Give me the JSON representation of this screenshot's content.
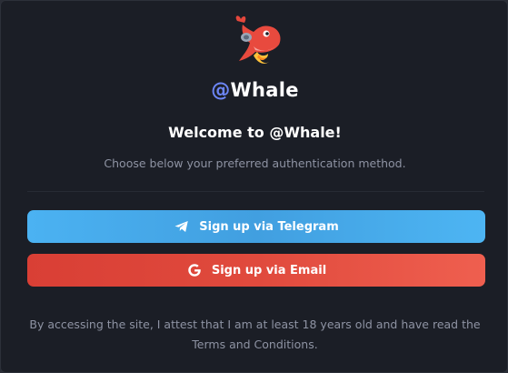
{
  "brand": {
    "at": "@",
    "name": "Whale"
  },
  "modal": {
    "title": "Welcome to @Whale!",
    "subtitle": "Choose below your preferred authentication method."
  },
  "buttons": {
    "telegram_label": "Sign up via Telegram",
    "email_label": "Sign up via Email"
  },
  "footer": {
    "text": "By accessing the site, I attest that I am at least 18 years old and have read the",
    "terms_link": "Terms and Conditions."
  },
  "icons": {
    "mascot": "whale-mascot-icon",
    "telegram": "telegram-icon",
    "email": "google-icon"
  },
  "colors": {
    "background": "#1b1e26",
    "brand_at": "#6c85f5",
    "telegram": "#4bb2f2",
    "email": "#e04a3d",
    "muted_text": "#8e93a3"
  }
}
